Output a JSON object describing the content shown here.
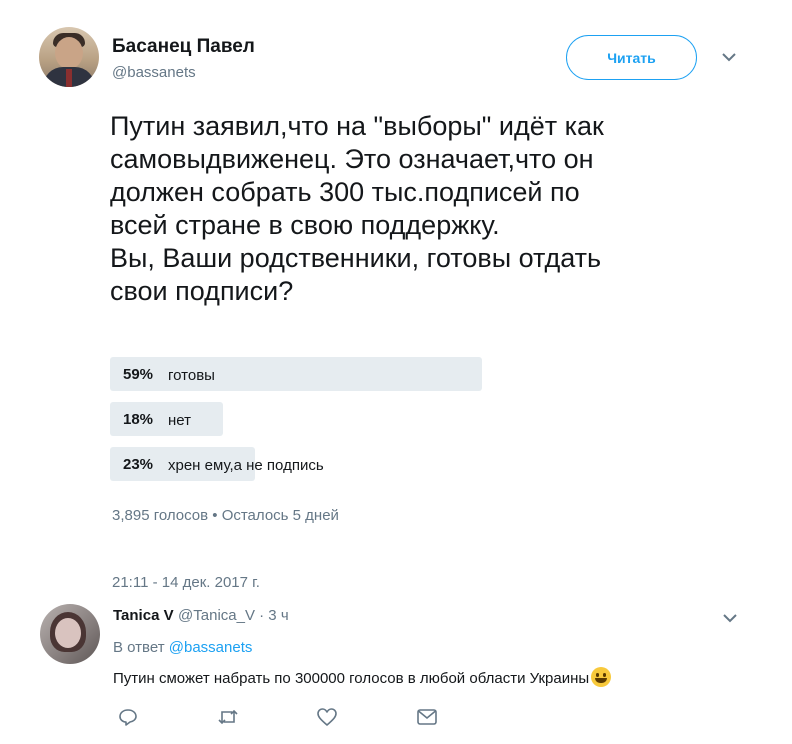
{
  "tweet": {
    "author_name": "Басанец Павел",
    "author_handle": "@bassanets",
    "follow_label": "Читать",
    "text": "Путин заявил,что на \"выборы\" идёт как\nсамовыдвиженец. Это означает,что он\nдолжен собрать 300 тыс.подписей по\nвсей стране в свою поддержку.\nВы, Ваши родственники, готовы отдать\nсвои подписи?",
    "poll": {
      "options": [
        {
          "percent_label": "59%",
          "label": "готовы",
          "fraction": 0.59
        },
        {
          "percent_label": "18%",
          "label": "нет",
          "fraction": 0.18
        },
        {
          "percent_label": "23%",
          "label": "хрен ему,а не подпись",
          "fraction": 0.23
        }
      ],
      "summary": "3,895 голосов • Осталось 5 дней"
    },
    "timestamp": "21:11 - 14 дек. 2017 г."
  },
  "reply": {
    "author_name": "Tanica V",
    "author_handle": "@Tanica_V · 3 ч",
    "reply_prefix": "В ответ ",
    "reply_to": "@bassanets",
    "text": "Путин сможет набрать по 300000 голосов в любой области Украины"
  },
  "icons": {
    "more": "chevron-down-icon",
    "actions": [
      "reply-icon",
      "retweet-icon",
      "like-icon",
      "message-icon"
    ]
  },
  "colors": {
    "accent": "#1da1f2",
    "secondary_text": "#657786",
    "poll_bar": "#e6ecf0"
  }
}
